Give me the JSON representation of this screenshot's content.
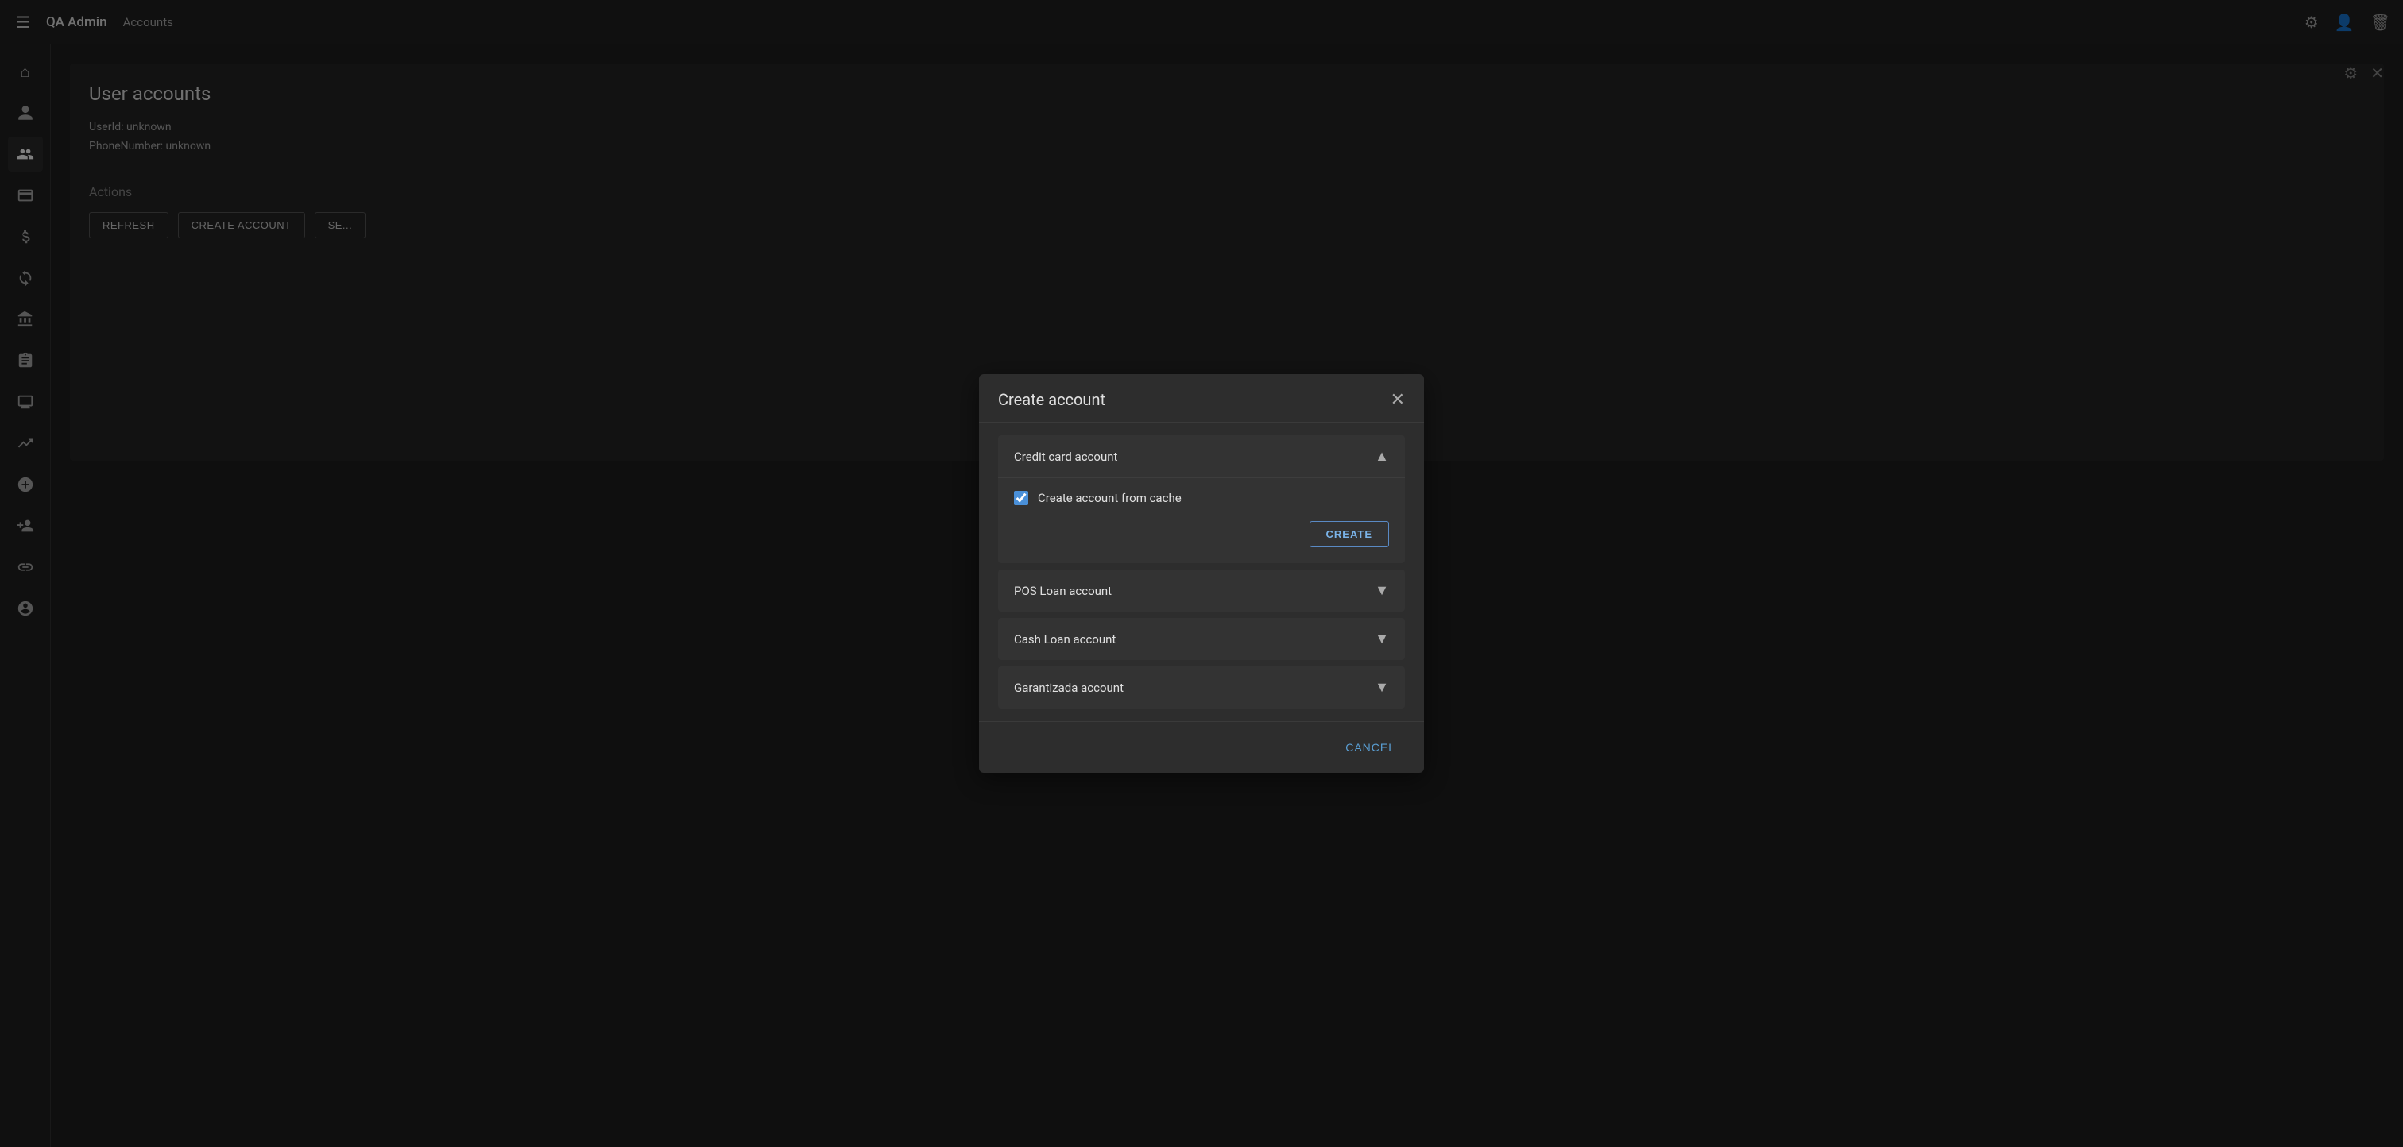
{
  "app": {
    "title": "QA Admin",
    "breadcrumb": "Accounts"
  },
  "topnav": {
    "icons": [
      "gear-icon",
      "person-icon",
      "trash-icon"
    ]
  },
  "sidebar": {
    "items": [
      {
        "name": "home-icon",
        "symbol": "⌂",
        "active": false
      },
      {
        "name": "person-icon",
        "symbol": "👤",
        "active": false
      },
      {
        "name": "group-icon",
        "symbol": "👥",
        "active": true
      },
      {
        "name": "card-icon",
        "symbol": "💳",
        "active": false
      },
      {
        "name": "dollar-icon",
        "symbol": "$",
        "active": false
      },
      {
        "name": "refresh-money-icon",
        "symbol": "↺",
        "active": false
      },
      {
        "name": "bank-icon",
        "symbol": "🏦",
        "active": false
      },
      {
        "name": "clipboard-icon",
        "symbol": "📋",
        "active": false
      },
      {
        "name": "monitor-icon",
        "symbol": "🖥",
        "active": false
      },
      {
        "name": "chart-icon",
        "symbol": "📈",
        "active": false
      },
      {
        "name": "add-circle-icon",
        "symbol": "⊕",
        "active": false
      },
      {
        "name": "person-add-icon",
        "symbol": "👤+",
        "active": false
      },
      {
        "name": "link-icon",
        "symbol": "🔗",
        "active": false
      },
      {
        "name": "person-outline-icon",
        "symbol": "👤",
        "active": false
      }
    ]
  },
  "main": {
    "page_title": "User accounts",
    "user_id_label": "UserId: unknown",
    "phone_label": "PhoneNumber: unknown",
    "actions": {
      "label": "Actions",
      "buttons": [
        {
          "label": "REFRESH",
          "name": "refresh-button"
        },
        {
          "label": "CREATE ACCOUNT",
          "name": "create-account-button"
        },
        {
          "label": "SE...",
          "name": "se-button"
        }
      ]
    },
    "main_top_icons": [
      {
        "name": "settings-icon",
        "symbol": "⚙"
      },
      {
        "name": "close-icon",
        "symbol": "✕"
      }
    ]
  },
  "modal": {
    "title": "Create account",
    "close_label": "✕",
    "accordion_items": [
      {
        "label": "Credit card account",
        "expanded": true,
        "chevron": "▲",
        "checkbox": {
          "checked": true,
          "label": "Create account from cache"
        },
        "create_button": "CREATE"
      },
      {
        "label": "POS Loan account",
        "expanded": false,
        "chevron": "▼"
      },
      {
        "label": "Cash Loan account",
        "expanded": false,
        "chevron": "▼"
      },
      {
        "label": "Garantizada account",
        "expanded": false,
        "chevron": "▼"
      }
    ],
    "cancel_button": "CANCEL"
  }
}
